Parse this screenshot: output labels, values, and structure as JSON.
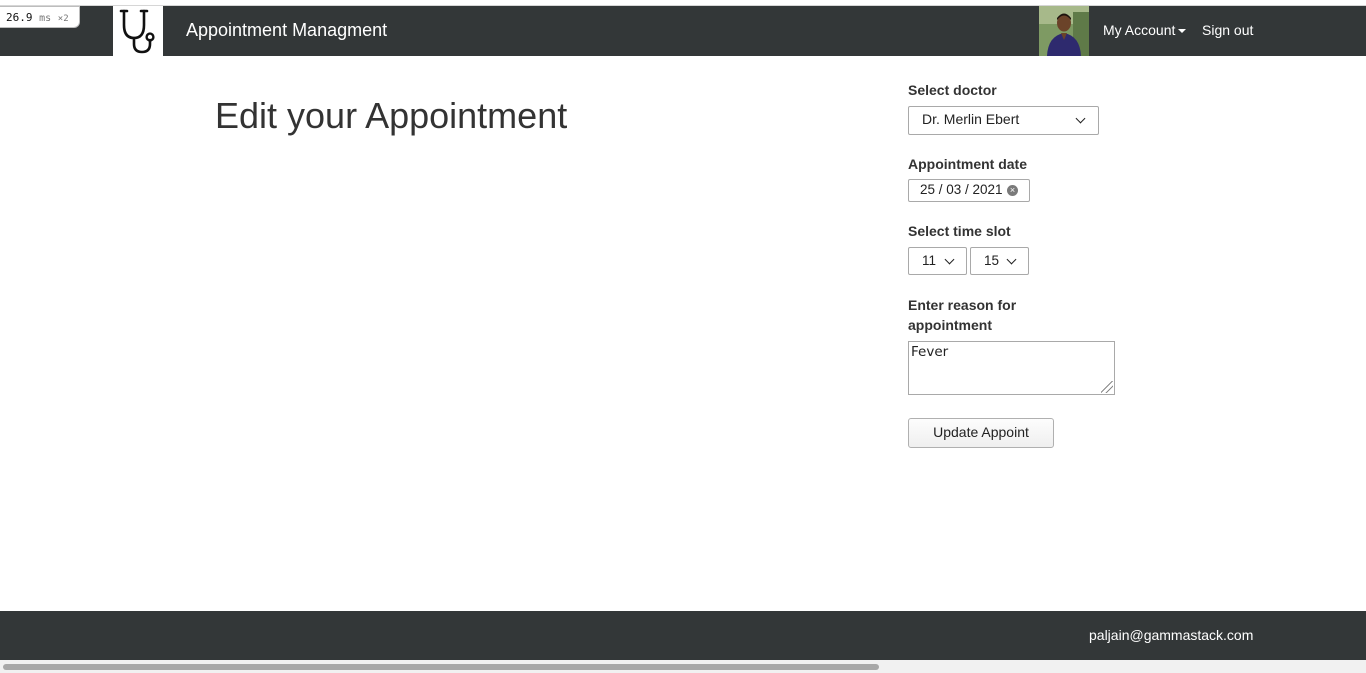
{
  "perf": {
    "value": "26.9",
    "unit": "ms",
    "multiplier": "×2"
  },
  "navbar": {
    "brand": "Appointment Managment",
    "account_label": "My Account",
    "signout_label": "Sign out"
  },
  "page": {
    "title": "Edit your Appointment"
  },
  "form": {
    "doctor_label": "Select doctor",
    "doctor_value": "Dr. Merlin Ebert",
    "date_label": "Appointment date",
    "date_value": "25 / 03 / 2021",
    "time_label": "Select time slot",
    "hour_value": "11",
    "minute_value": "15",
    "reason_label": "Enter reason for appointment",
    "reason_value": "Fever",
    "submit_label": "Update Appoint"
  },
  "footer": {
    "email": "paljain@gammastack.com"
  },
  "colors": {
    "navbar_bg": "#333738",
    "footer_bg": "#333738",
    "text": "#333333"
  }
}
